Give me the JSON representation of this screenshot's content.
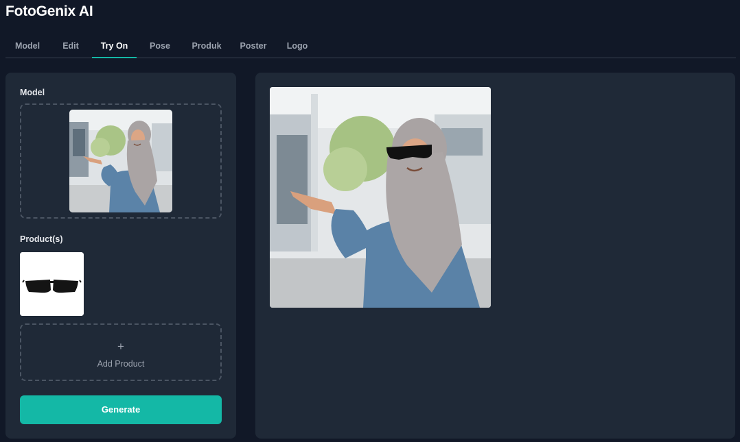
{
  "app": {
    "title": "FotoGenix AI"
  },
  "tabs": [
    {
      "label": "Model"
    },
    {
      "label": "Edit"
    },
    {
      "label": "Try On",
      "active": true
    },
    {
      "label": "Pose"
    },
    {
      "label": "Produk"
    },
    {
      "label": "Poster"
    },
    {
      "label": "Logo"
    }
  ],
  "left_panel": {
    "model_label": "Model",
    "products_label": "Product(s)",
    "add_product_icon": "+",
    "add_product_label": "Add Product",
    "generate_label": "Generate"
  },
  "images": {
    "model_thumbnail": "woman-in-hijab-pointing",
    "product_thumbnail": "black-sunglasses",
    "result": "woman-in-hijab-wearing-sunglasses-pointing"
  },
  "colors": {
    "accent": "#14b8a6",
    "background": "#111827",
    "panel": "#1f2937"
  }
}
